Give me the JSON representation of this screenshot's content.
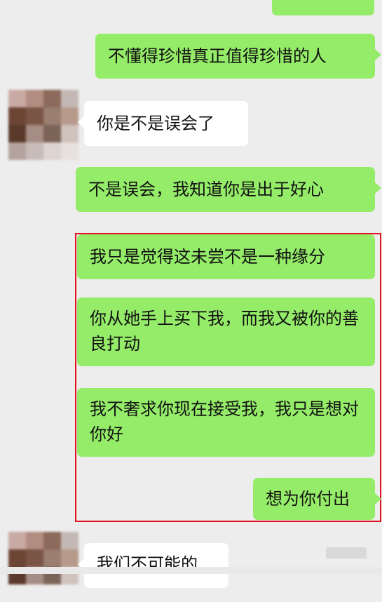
{
  "chat": {
    "messages": [
      {
        "sender": "self",
        "text": "不懂得珍惜真正值得珍惜的人"
      },
      {
        "sender": "other",
        "text": "你是不是误会了"
      },
      {
        "sender": "self",
        "text": "不是误会，我知道你是出于好心"
      },
      {
        "sender": "self",
        "text": "我只是觉得这未尝不是一种缘分",
        "highlighted": true
      },
      {
        "sender": "self",
        "text": "你从她手上买下我，而我又被你的善良打动",
        "highlighted": true
      },
      {
        "sender": "self",
        "text": "我不奢求你现在接受我，我只是想对你好",
        "highlighted": true
      },
      {
        "sender": "self",
        "text": "想为你付出",
        "highlighted": true
      },
      {
        "sender": "other",
        "text": "我们不可能的"
      }
    ]
  },
  "colors": {
    "self_bubble": "#95ec69",
    "other_bubble": "#ffffff",
    "background": "#ededed",
    "highlight_border": "#e0141e"
  }
}
